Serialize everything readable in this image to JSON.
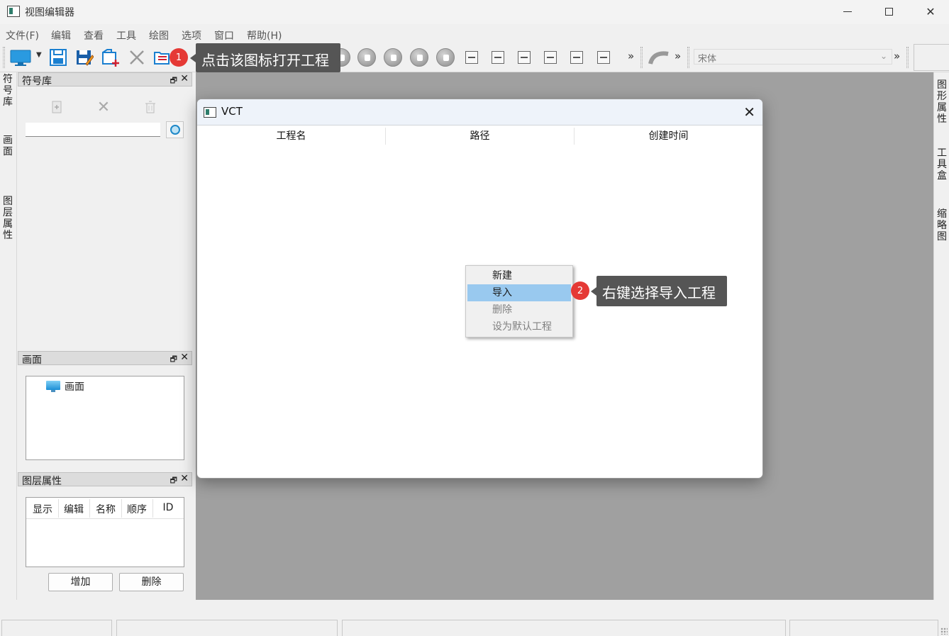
{
  "window": {
    "title": "视图编辑器"
  },
  "menu": [
    "文件(F)",
    "编辑",
    "查看",
    "工具",
    "绘图",
    "选项",
    "窗口",
    "帮助(H)"
  ],
  "toolbar": {
    "font_value": "宋体",
    "overflow": "»"
  },
  "callouts": {
    "step1_num": "1",
    "step1_text": "点击该图标打开工程",
    "step2_num": "2",
    "step2_text": "右键选择导入工程"
  },
  "left_tabs": [
    "符号库",
    "画面",
    "图层属性"
  ],
  "right_tabs": [
    "图形属性",
    "工具盒",
    "缩略图"
  ],
  "symbol_panel": {
    "title": "符号库",
    "float": "🗗",
    "close": "✕"
  },
  "screen_panel": {
    "title": "画面",
    "float": "🗗",
    "close": "✕",
    "tree_item": "画面"
  },
  "layer_panel": {
    "title": "图层属性",
    "float": "🗗",
    "close": "✕",
    "columns": [
      "显示",
      "编辑",
      "名称",
      "顺序",
      "ID"
    ],
    "add_button": "增加",
    "delete_button": "删除"
  },
  "dialog": {
    "title": "VCT",
    "close": "✕",
    "columns": [
      "工程名",
      "路径",
      "创建时间"
    ]
  },
  "context_menu": {
    "items": [
      {
        "label": "新建",
        "state": "normal"
      },
      {
        "label": "导入",
        "state": "highlighted"
      },
      {
        "label": "删除",
        "state": "disabled"
      },
      {
        "label": "设为默认工程",
        "state": "disabled"
      }
    ]
  },
  "colors": {
    "badge": "#e53935",
    "callout_bg": "#555555",
    "highlight": "#99c9ef",
    "mdi_bg": "#a0a0a0"
  }
}
